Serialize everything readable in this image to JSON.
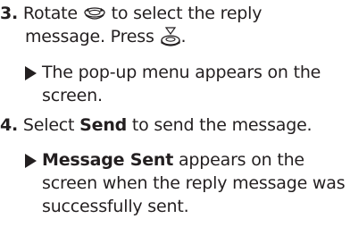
{
  "steps": [
    {
      "number": "3.",
      "text_part1": "Rotate",
      "icon1": "rotate-dial-icon",
      "text_part2": "to select the reply",
      "text_line2": "message. Press",
      "icon2": "press-dial-icon",
      "text_line2_end": ".",
      "sub_text": "The pop-up menu appears on the screen."
    },
    {
      "number": "4.",
      "text_part1": "Select",
      "bold_word": "Send",
      "text_part2": "to send the message.",
      "sub_bold": "Message Sent",
      "sub_text": "appears on the screen when the reply message was successfully sent."
    }
  ]
}
